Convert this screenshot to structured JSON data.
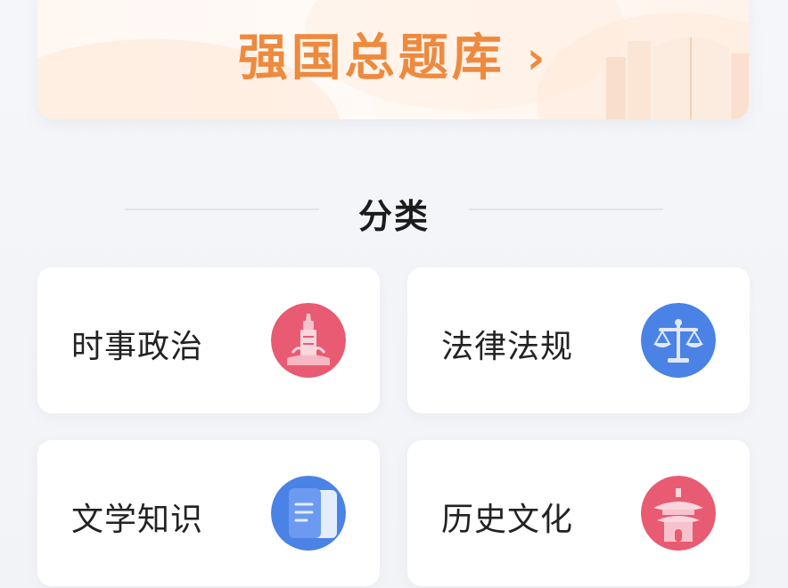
{
  "banner": {
    "title": "强国总题库",
    "chevron": "›"
  },
  "section": {
    "title": "分类"
  },
  "categories": [
    {
      "label": "时事政治",
      "icon": "monument-icon",
      "color": "#e85b72"
    },
    {
      "label": "法律法规",
      "icon": "scales-icon",
      "color": "#4a82e6"
    },
    {
      "label": "文学知识",
      "icon": "document-icon",
      "color": "#4a82e6"
    },
    {
      "label": "历史文化",
      "icon": "pavilion-icon",
      "color": "#e85b72"
    }
  ],
  "colors": {
    "accent_orange": "#ee8a3e",
    "icon_red": "#e85b72",
    "icon_blue": "#4a82e6"
  }
}
